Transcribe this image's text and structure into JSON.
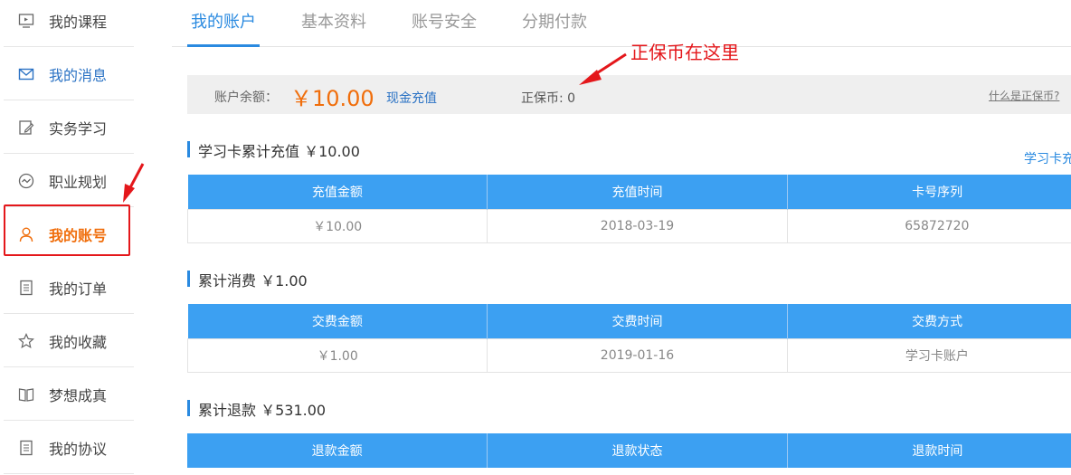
{
  "sidebar": {
    "items": [
      {
        "label": "我的课程",
        "icon": "monitor-play-icon"
      },
      {
        "label": "我的消息",
        "icon": "envelope-icon"
      },
      {
        "label": "实务学习",
        "icon": "edit-icon"
      },
      {
        "label": "职业规划",
        "icon": "trend-circle-icon"
      },
      {
        "label": "我的账号",
        "icon": "user-icon"
      },
      {
        "label": "我的订单",
        "icon": "document-icon"
      },
      {
        "label": "我的收藏",
        "icon": "star-icon"
      },
      {
        "label": "梦想成真",
        "icon": "open-book-icon"
      },
      {
        "label": "我的协议",
        "icon": "document-icon"
      }
    ],
    "active_index": 4
  },
  "tabs": [
    "我的账户",
    "基本资料",
    "账号安全",
    "分期付款"
  ],
  "balance": {
    "label": "账户余额：",
    "amount": "￥10.00",
    "recharge_link": "现金充值",
    "coin": "正保币: 0",
    "what_link": "什么是正保币?"
  },
  "annotation": "正保币在这里",
  "card": {
    "title": "学习卡累计充值 ￥10.00",
    "right_link": "学习卡充",
    "headers": [
      "充值金额",
      "充值时间",
      "卡号序列"
    ],
    "rows": [
      [
        "￥10.00",
        "2018-03-19",
        "65872720"
      ]
    ]
  },
  "consume": {
    "title": "累计消费 ￥1.00",
    "headers": [
      "交费金额",
      "交费时间",
      "交费方式"
    ],
    "rows": [
      [
        "￥1.00",
        "2019-01-16",
        "学习卡账户"
      ]
    ]
  },
  "refund": {
    "title": "累计退款 ￥531.00",
    "headers": [
      "退款金额",
      "退款状态",
      "退款时间"
    ]
  },
  "colors": {
    "accent": "#2a8ae0",
    "header_bg": "#3ca0f2",
    "amount": "#f06e0c",
    "annotation": "#e4171b"
  }
}
